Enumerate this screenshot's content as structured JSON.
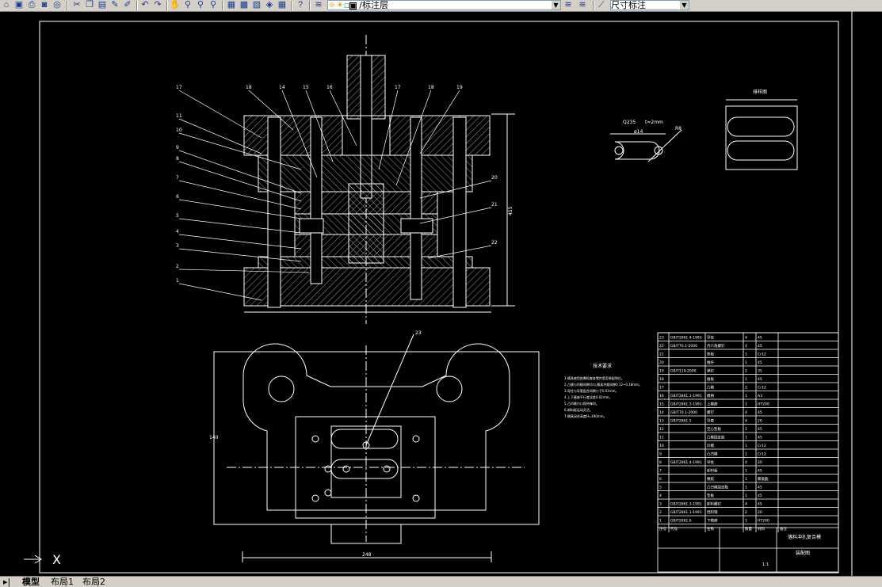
{
  "toolbar": {
    "layer_combo_value": "/标注层",
    "dim_style_combo_value": "尺寸标注",
    "icons": [
      "open-icon",
      "save-icon",
      "print-icon",
      "preview-icon",
      "cut-icon",
      "copy-icon",
      "paste-icon",
      "match-prop-icon",
      "undo-icon",
      "redo-icon",
      "pan-icon",
      "zoom-realtime-icon",
      "zoom-window-icon",
      "zoom-previous-icon",
      "properties-icon",
      "design-center-icon",
      "tool-palette-icon",
      "markup-icon",
      "calculator-icon",
      "help-icon",
      "layer-manager-icon",
      "layer-state-icon"
    ]
  },
  "tabs": {
    "nav_label": "▸|",
    "model": "模型",
    "layout1": "布局1",
    "layout2": "布局2"
  },
  "ucs": {
    "x_label": "X"
  },
  "drawing": {
    "section_labels": [
      "17",
      "18",
      "14",
      "15",
      "16",
      "17",
      "18",
      "19",
      "11",
      "10",
      "9",
      "8",
      "7",
      "6",
      "5",
      "4",
      "3",
      "2",
      "1",
      "20",
      "21",
      "22"
    ],
    "dim_height": "455",
    "plan_dim_width": "248",
    "plan_dim_height": "140",
    "plan_label": "23",
    "part_label": "Q235",
    "part_dims": [
      "t=2mm",
      "ø14",
      "R8"
    ],
    "layout_title": "排样图",
    "notes_title": "技术要求",
    "notes": [
      "1.模具使用前需检查各零件是否装配到位。",
      "2.凸模与凹模间隙均匀,模具冲裁间隙0.12~0.18mm。",
      "3.导柱与导套配合间隙小于0.01mm。",
      "4.上下模座平行度误差0.02mm。",
      "5.凸凹模刃口保持锋利。",
      "6.卸料板运动灵活。",
      "7.模具闭合高度H=190mm。"
    ],
    "title_block": {
      "title": "落料冲孔复合模",
      "subtitle": "装配图",
      "scale": "1:1"
    },
    "bom": [
      {
        "no": "23",
        "code": "GB/T2861.4-1991",
        "name": "导柱",
        "qty": "4",
        "mat": "45"
      },
      {
        "no": "22",
        "code": "GB/T70.1-2000",
        "name": "内六角螺钉",
        "qty": "4",
        "mat": "45"
      },
      {
        "no": "21",
        "code": "",
        "name": "垫板",
        "qty": "1",
        "mat": "Cr12"
      },
      {
        "no": "20",
        "code": "",
        "name": "推杆",
        "qty": "1",
        "mat": "45"
      },
      {
        "no": "19",
        "code": "GB/T119-2000",
        "name": "销钉",
        "qty": "2",
        "mat": "35"
      },
      {
        "no": "18",
        "code": "",
        "name": "推板",
        "qty": "1",
        "mat": "45"
      },
      {
        "no": "17",
        "code": "",
        "name": "凸模",
        "qty": "2",
        "mat": "Cr12"
      },
      {
        "no": "16",
        "code": "GB/T2861.1-1991",
        "name": "模柄",
        "qty": "1",
        "mat": "A3"
      },
      {
        "no": "15",
        "code": "GB/T2861.3-1991",
        "name": "上模座",
        "qty": "1",
        "mat": "HT200"
      },
      {
        "no": "14",
        "code": "GB/T70.1-2000",
        "name": "螺钉",
        "qty": "4",
        "mat": "45"
      },
      {
        "no": "13",
        "code": "GB/T2861.5",
        "name": "导套",
        "qty": "4",
        "mat": "20"
      },
      {
        "no": "12",
        "code": "",
        "name": "空心垫板",
        "qty": "1",
        "mat": "45"
      },
      {
        "no": "11",
        "code": "",
        "name": "凸模固定板",
        "qty": "1",
        "mat": "45"
      },
      {
        "no": "10",
        "code": "",
        "name": "凹模",
        "qty": "1",
        "mat": "Cr12"
      },
      {
        "no": "9",
        "code": "",
        "name": "凸凹模",
        "qty": "1",
        "mat": "Cr12"
      },
      {
        "no": "8",
        "code": "GB/T2861.4-1991",
        "name": "导柱",
        "qty": "4",
        "mat": "20"
      },
      {
        "no": "7",
        "code": "",
        "name": "卸料板",
        "qty": "1",
        "mat": "45"
      },
      {
        "no": "6",
        "code": "",
        "name": "橡胶",
        "qty": "1",
        "mat": "聚氨酯"
      },
      {
        "no": "5",
        "code": "",
        "name": "凸凹模固定板",
        "qty": "1",
        "mat": "45"
      },
      {
        "no": "4",
        "code": "",
        "name": "垫板",
        "qty": "1",
        "mat": "45"
      },
      {
        "no": "3",
        "code": "GB/T2861.3-1991",
        "name": "卸料螺钉",
        "qty": "4",
        "mat": "45"
      },
      {
        "no": "2",
        "code": "GB/T2861.1-1991",
        "name": "挡料销",
        "qty": "2",
        "mat": "20"
      },
      {
        "no": "1",
        "code": "GB/T2861.6",
        "name": "下模座",
        "qty": "1",
        "mat": "HT200"
      }
    ],
    "bom_header": {
      "no": "序号",
      "code": "代号",
      "name": "名称",
      "qty": "数量",
      "mat": "材料",
      "note": "备注"
    }
  }
}
